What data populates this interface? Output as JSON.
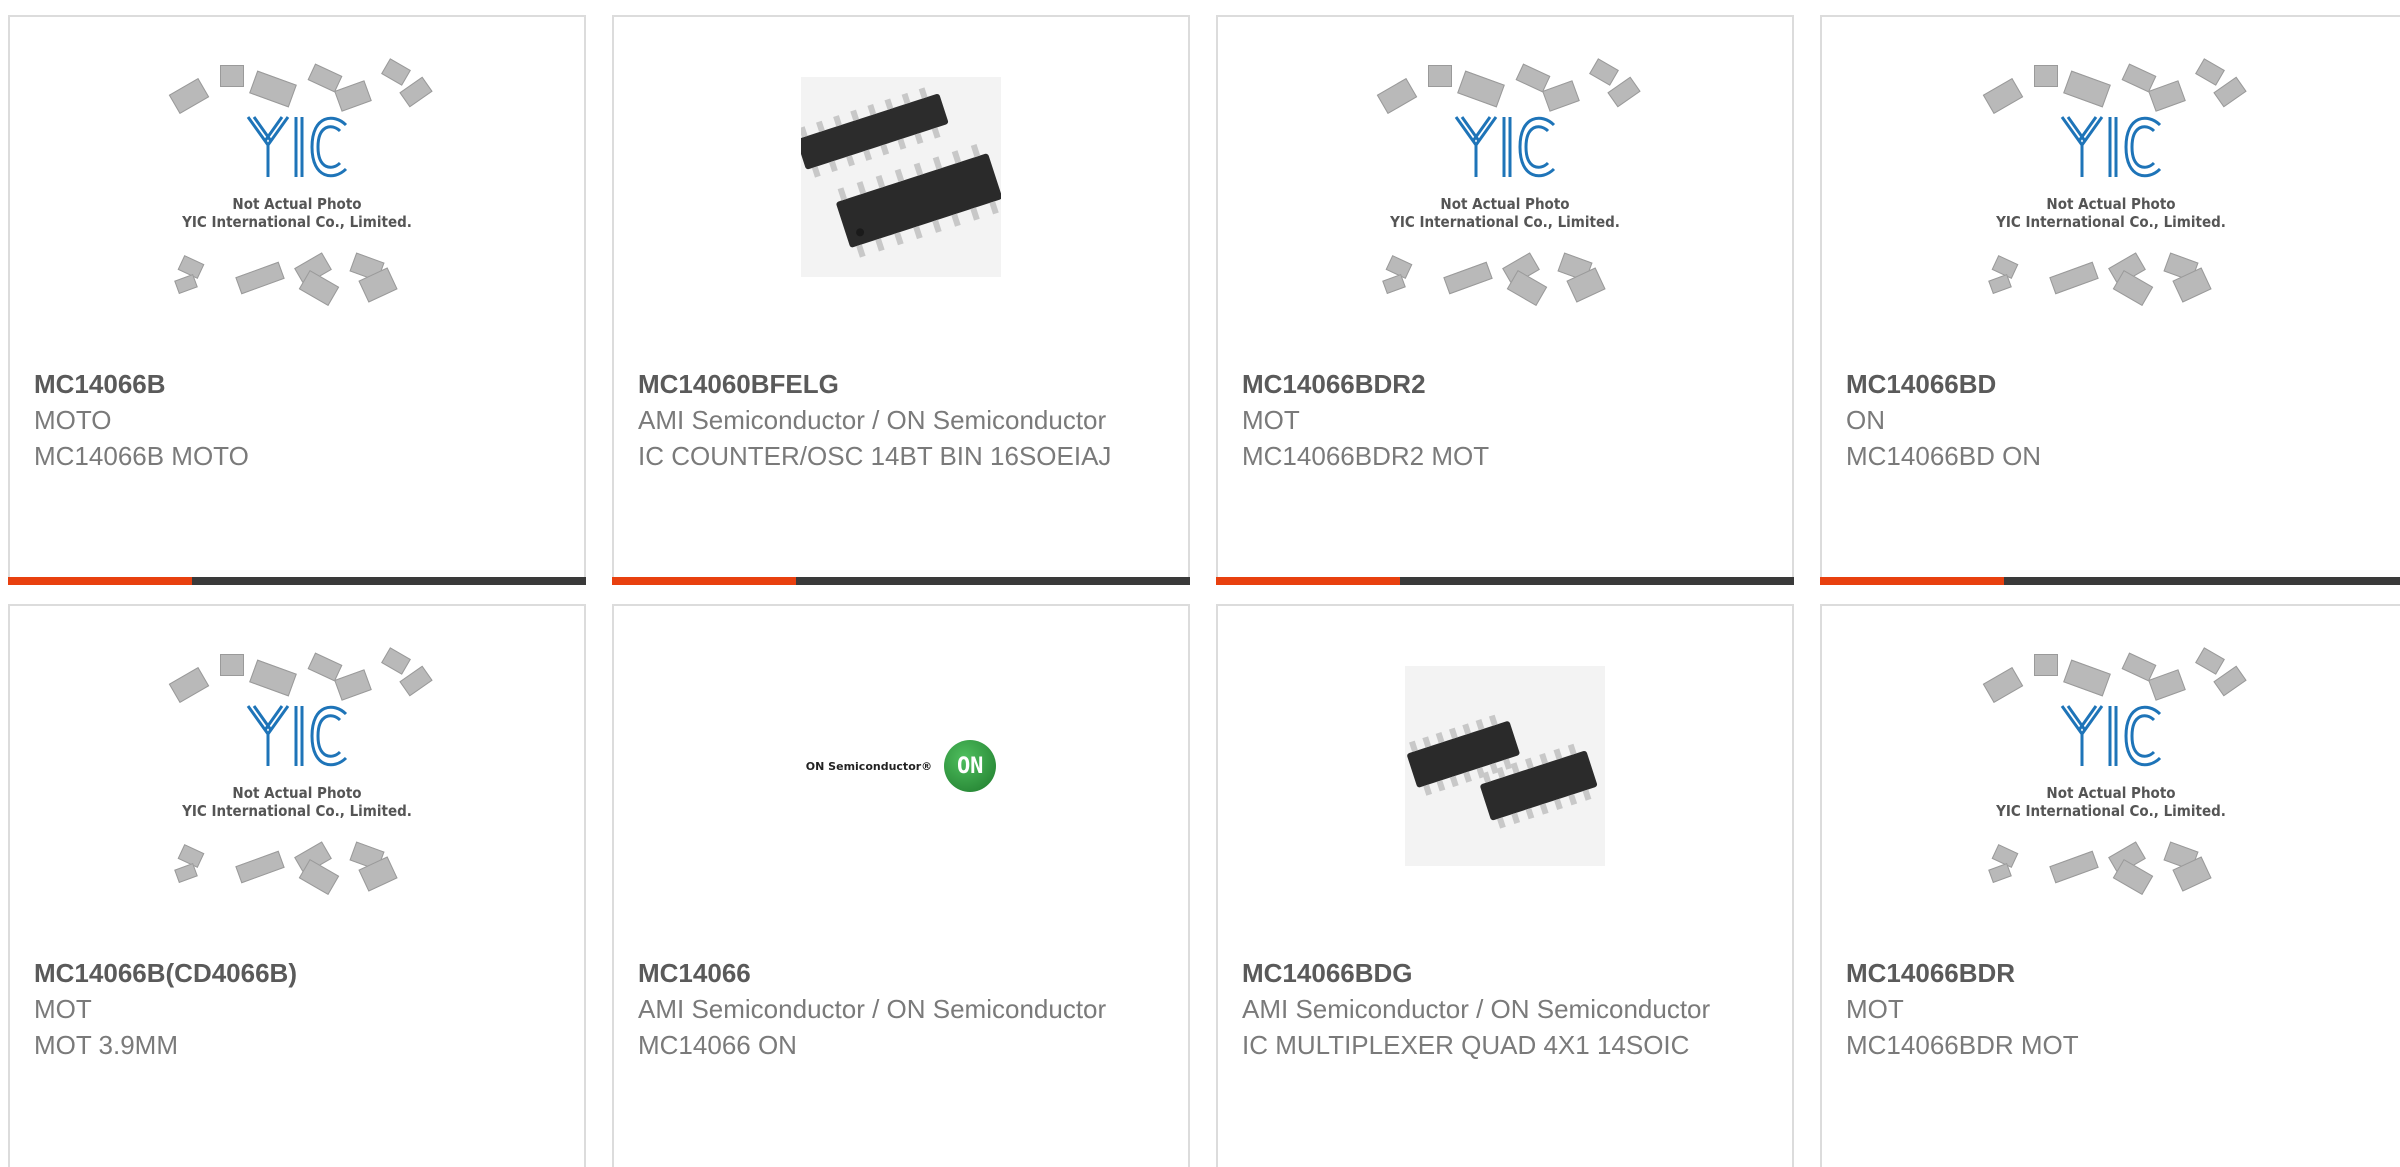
{
  "placeholder": {
    "line1": "Not Actual Photo",
    "line2": "YIC International Co., Limited.",
    "logo_text": "YIC"
  },
  "on_logo": {
    "word": "ON Semiconductor®",
    "mark": "ON"
  },
  "colors": {
    "accent": "#e8400f",
    "bar": "#3a3a3a",
    "border": "#dcdcdc",
    "logo_blue": "#1e74b8"
  },
  "products": [
    {
      "part": "MC14066B",
      "maker": "MOTO",
      "desc": "MC14066B MOTO",
      "image": "placeholder"
    },
    {
      "part": "MC14060BFELG",
      "maker": "AMI Semiconductor / ON Semiconductor",
      "desc": "IC COUNTER/OSC 14BT BIN 16SOEIAJ",
      "image": "chip-photo"
    },
    {
      "part": "MC14066BDR2",
      "maker": "MOT",
      "desc": "MC14066BDR2 MOT",
      "image": "placeholder"
    },
    {
      "part": "MC14066BD",
      "maker": "ON",
      "desc": "MC14066BD ON",
      "image": "placeholder"
    },
    {
      "part": "MC14066B(CD4066B)",
      "maker": "MOT",
      "desc": "MOT 3.9MM",
      "image": "placeholder"
    },
    {
      "part": "MC14066",
      "maker": "AMI Semiconductor / ON Semiconductor",
      "desc": "MC14066 ON",
      "image": "on-logo"
    },
    {
      "part": "MC14066BDG",
      "maker": "AMI Semiconductor / ON Semiconductor",
      "desc": "IC MULTIPLEXER QUAD 4X1 14SOIC",
      "image": "chip-photo"
    },
    {
      "part": "MC14066BDR",
      "maker": "MOT",
      "desc": "MC14066BDR MOT",
      "image": "placeholder"
    }
  ]
}
